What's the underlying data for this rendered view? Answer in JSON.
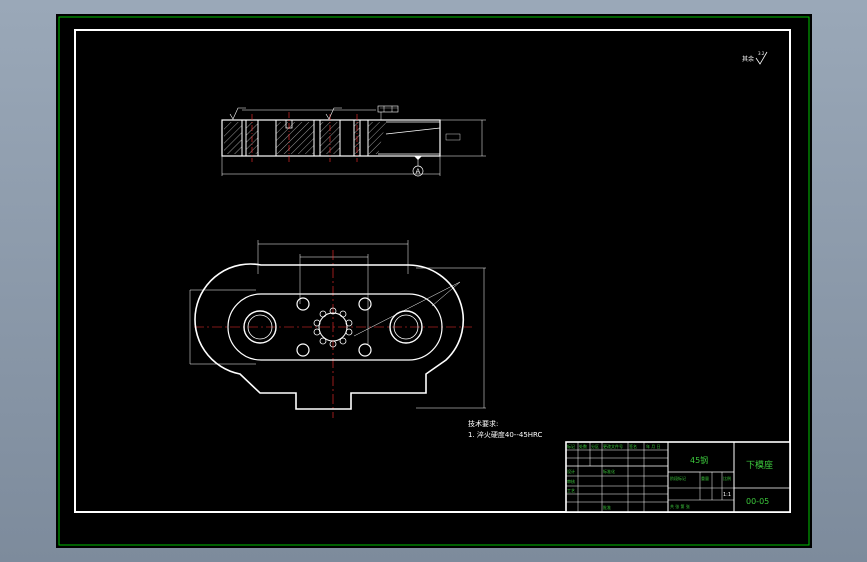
{
  "colors": {
    "background": "#8c9aab",
    "canvas": "#000000",
    "sheet_border": "#00c000",
    "drawing_lines": "#ffffff",
    "center_lines": "#ff3030",
    "text": "#ffffff",
    "title_block_text": "#3cc83c"
  },
  "drawing": {
    "roughness_note": "其余",
    "roughness_value": "3.2",
    "datum_label": "A",
    "tolerance_frame": "0.02 A",
    "tech_req_title": "技术要求:",
    "tech_req_item": "1. 淬火硬度40--45HRC"
  },
  "title_block": {
    "material": "45钢",
    "part_name": "下模座",
    "drawing_number": "00-05",
    "scale": "1:1",
    "labels": {
      "mark": "标记",
      "count": "处数",
      "zone": "分区",
      "change_doc": "更改文件号",
      "signature": "签名",
      "date": "年 月 日",
      "design": "设计",
      "standardize": "标准化",
      "review": "审核",
      "process": "工艺",
      "approve": "批准",
      "stage_mark": "阶段标记",
      "weight": "重量",
      "scale_label": "比例",
      "sheet": "共 张 第 张"
    }
  }
}
